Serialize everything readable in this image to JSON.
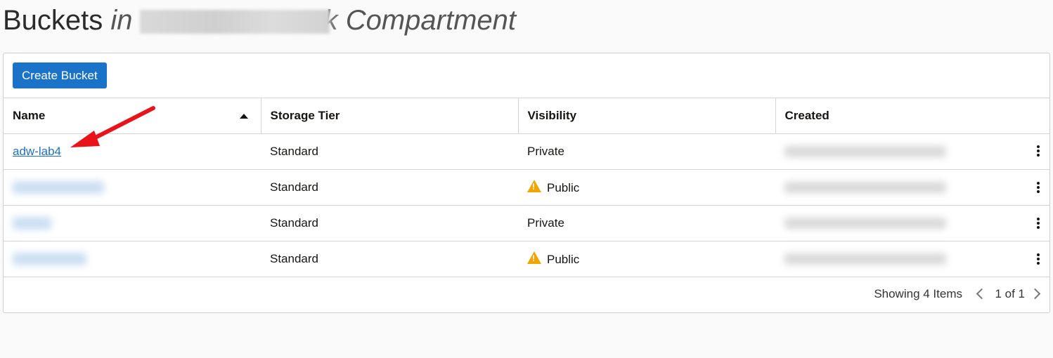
{
  "header": {
    "title_main": "Buckets",
    "title_in": "in",
    "title_tail": "k",
    "title_compartment": "Compartment"
  },
  "toolbar": {
    "create_label": "Create Bucket"
  },
  "table": {
    "columns": [
      "Name",
      "Storage Tier",
      "Visibility",
      "Created"
    ],
    "sort_column": "Name",
    "sort_direction": "ascending",
    "rows": [
      {
        "name": "adw-lab4",
        "tier": "Standard",
        "visibility": "Private"
      },
      {
        "name": "",
        "tier": "Standard",
        "visibility": "Public"
      },
      {
        "name": "",
        "tier": "Standard",
        "visibility": "Private"
      },
      {
        "name": "",
        "tier": "Standard",
        "visibility": "Public"
      }
    ]
  },
  "footer": {
    "showing": "Showing 4 Items",
    "page": "1 of 1"
  },
  "colors": {
    "accent": "#1a73c8",
    "warning": "#f0a500",
    "annotation_arrow": "#e8141a"
  },
  "icons": [
    "sort-ascending-icon",
    "warning-icon",
    "kebab-menu-icon",
    "chevron-left-icon",
    "chevron-right-icon",
    "annotation-arrow"
  ]
}
